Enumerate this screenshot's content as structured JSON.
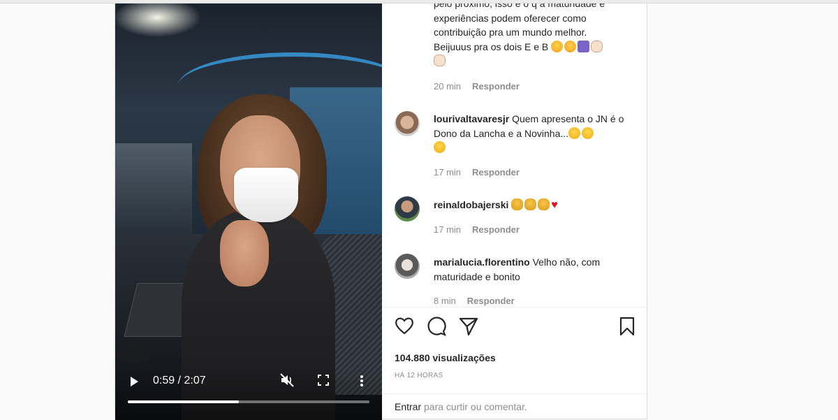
{
  "video": {
    "current_time": "0:59",
    "duration": "2:07",
    "time_display": "0:59 / 2:07",
    "progress_fraction": 0.46
  },
  "comments": {
    "first_partial": {
      "line_top": "pelo próximo, isso é o q a maturidade e",
      "line_1": "experiências podem oferecer como",
      "line_2": "contribuição pra um mundo melhor.",
      "line_3": "Beijuuus pra os dois E e B",
      "time": "20 min",
      "reply": "Responder"
    },
    "items": [
      {
        "username": "lourivaltavaresjr",
        "text": "Quem apresenta o JN é o Dono da Lancha e a Novinha...",
        "time": "17 min",
        "reply": "Responder"
      },
      {
        "username": "reinaldobajerski",
        "text": "",
        "time": "17 min",
        "reply": "Responder"
      },
      {
        "username": "marialucia.florentino",
        "text": "Velho não, com maturidade e bonito",
        "time": "8 min",
        "reply": "Responder"
      }
    ]
  },
  "stats": {
    "views": "104.880 visualizações",
    "posted": "HÁ 12 HORAS"
  },
  "footer": {
    "login_link": "Entrar",
    "login_text": "para curtir ou comentar."
  },
  "colors": {
    "text": "#262626",
    "muted": "#8e8e8e",
    "border": "#dbdbdb",
    "heart": "#e0102b"
  },
  "icons": [
    "play-icon",
    "mute-icon",
    "fullscreen-icon",
    "more-icon",
    "heart-icon",
    "comment-icon",
    "share-icon",
    "bookmark-icon"
  ]
}
